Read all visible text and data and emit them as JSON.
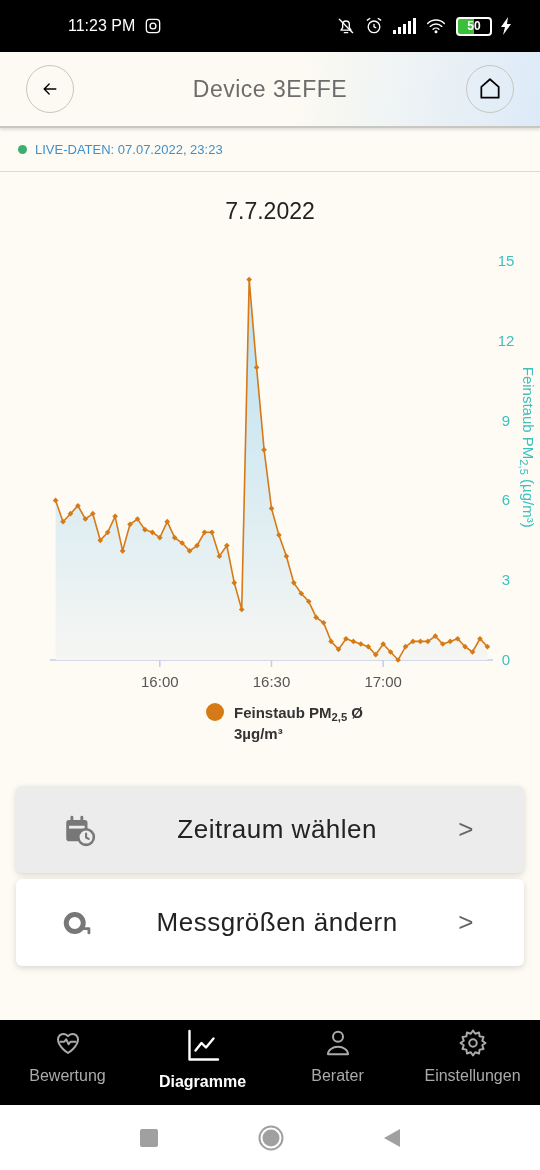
{
  "status_bar": {
    "time": "11:23 PM",
    "battery": "50"
  },
  "header": {
    "title": "Device 3EFFE"
  },
  "live": {
    "text": "LIVE-DATEN: 07.07.2022, 23:23",
    "color": "#3dae6e"
  },
  "chart": {
    "title": "7.7.2022",
    "chart_data": {
      "type": "area",
      "ylabel": "Feinstaub PM$_{2,5}$ (µg/m³)",
      "x": [
        932,
        934,
        936,
        938,
        940,
        942,
        944,
        946,
        948,
        950,
        952,
        954,
        956,
        958,
        960,
        962,
        964,
        966,
        968,
        970,
        972,
        974,
        976,
        978,
        980,
        982,
        984,
        986,
        988,
        990,
        992,
        994,
        996,
        998,
        1000,
        1002,
        1004,
        1006,
        1008,
        1010,
        1012,
        1014,
        1016,
        1018,
        1020,
        1022,
        1024,
        1026,
        1028,
        1030,
        1032,
        1034,
        1036,
        1038,
        1040,
        1042,
        1044,
        1046,
        1048
      ],
      "series": [
        {
          "name": "Feinstaub PM$_{2,5}$ Ø 3µg/m³",
          "color": "#d67a17",
          "values": [
            6.0,
            5.2,
            5.5,
            5.8,
            5.3,
            5.5,
            4.5,
            4.8,
            5.4,
            4.1,
            5.1,
            5.3,
            4.9,
            4.8,
            4.6,
            5.2,
            4.6,
            4.4,
            4.1,
            4.3,
            4.8,
            4.8,
            3.9,
            4.3,
            2.9,
            1.9,
            14.3,
            11.0,
            7.9,
            5.7,
            4.7,
            3.9,
            2.9,
            2.5,
            2.2,
            1.6,
            1.4,
            0.7,
            0.4,
            0.8,
            0.7,
            0.6,
            0.5,
            0.2,
            0.6,
            0.3,
            0.0,
            0.5,
            0.7,
            0.7,
            0.7,
            0.9,
            0.6,
            0.7,
            0.8,
            0.5,
            0.3,
            0.8,
            0.5
          ]
        }
      ],
      "xlim": [
        930.5,
        1049.5
      ],
      "ylim": [
        0,
        15
      ],
      "xticks": [
        {
          "value": 960,
          "label": "16:00"
        },
        {
          "value": 990,
          "label": "16:30"
        },
        {
          "value": 1020,
          "label": "17:00"
        }
      ],
      "yticks": [
        0,
        3,
        6,
        9,
        12,
        15
      ]
    }
  },
  "actions": [
    {
      "label": "Zeitraum wählen",
      "kind": "calendar",
      "highlighted": true,
      "chevron": ">"
    },
    {
      "label": "Messgrößen ändern",
      "kind": "gauge",
      "highlighted": false,
      "chevron": ">"
    }
  ],
  "nav": [
    {
      "label": "Bewertung",
      "kind": "heart",
      "selected": false
    },
    {
      "label": "Diagramme",
      "kind": "chart",
      "selected": true
    },
    {
      "label": "Berater",
      "kind": "person",
      "selected": false
    },
    {
      "label": "Einstellungen",
      "kind": "gear",
      "selected": false
    }
  ]
}
